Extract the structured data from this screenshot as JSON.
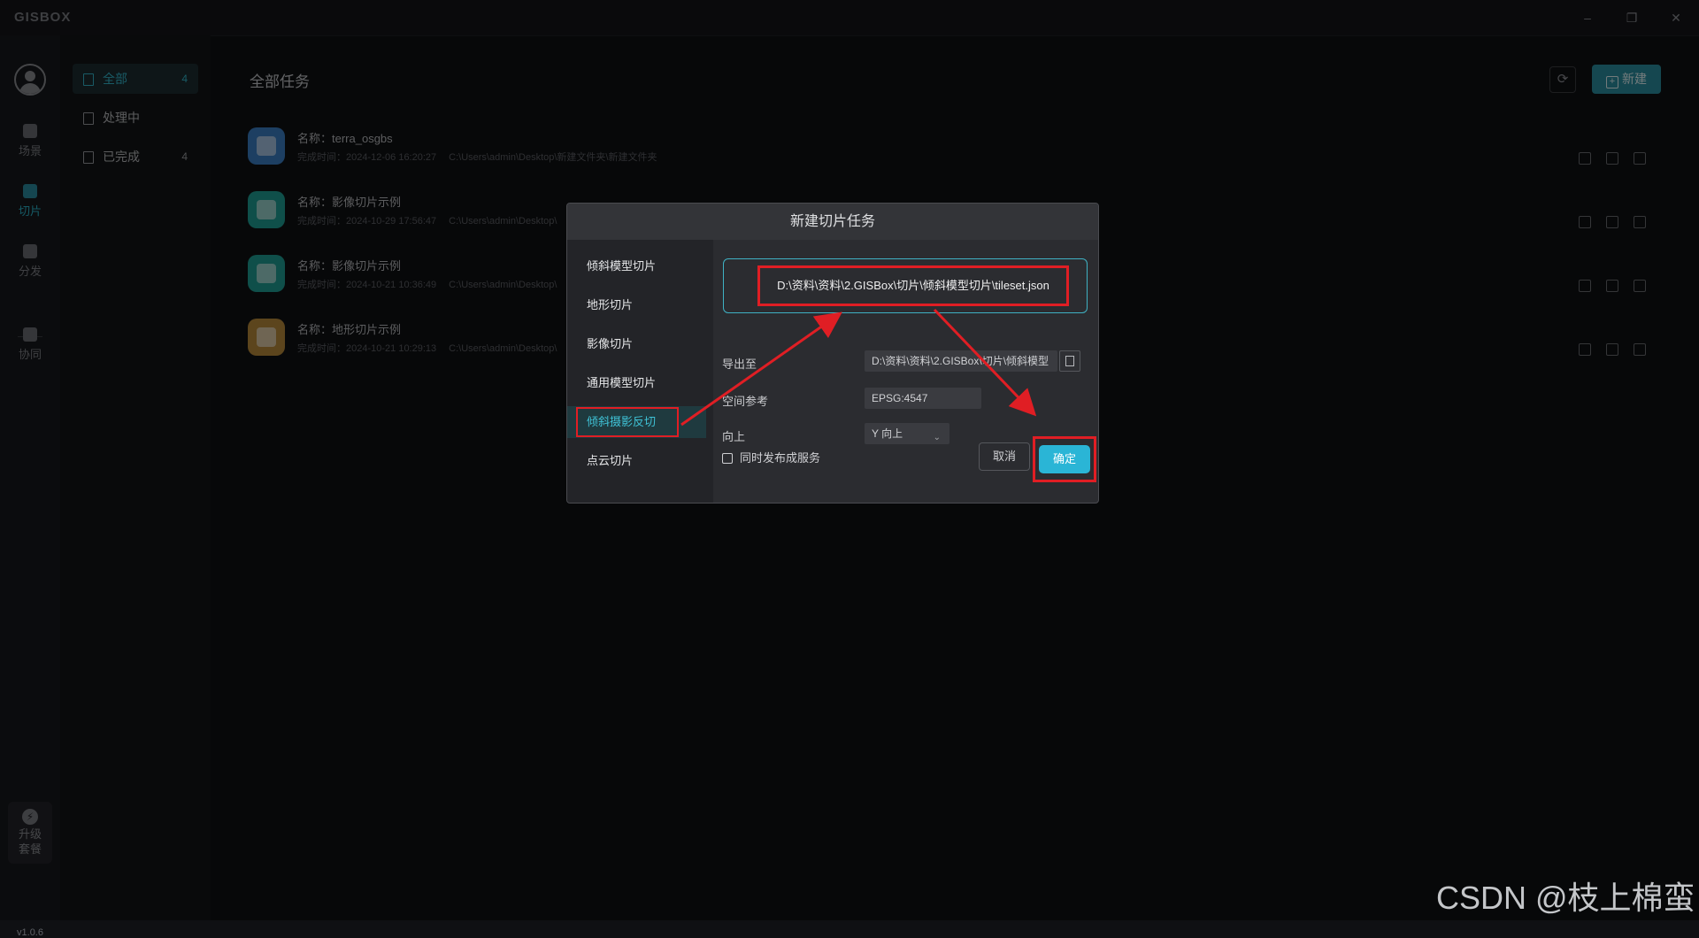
{
  "app": {
    "logo": "GISBOX",
    "window_controls": {
      "minimize": "–",
      "restore": "❐",
      "close": "✕"
    },
    "version": "v1.0.6"
  },
  "rail": {
    "items": [
      {
        "label": "场景",
        "icon": "home-icon"
      },
      {
        "label": "切片",
        "icon": "slice-icon",
        "active": true
      },
      {
        "label": "分发",
        "icon": "distribute-icon"
      },
      {
        "label": "协同",
        "icon": "lock-icon"
      }
    ],
    "upgrade": {
      "line1": "升级",
      "line2": "套餐",
      "icon": "bolt-icon",
      "glyph": "⚡"
    }
  },
  "filter": {
    "items": [
      {
        "label": "全部",
        "count": "4",
        "active": true
      },
      {
        "label": "处理中",
        "count": ""
      },
      {
        "label": "已完成",
        "count": "4"
      }
    ]
  },
  "main": {
    "title": "全部任务",
    "refresh_glyph": "⟳",
    "new_label": "新建",
    "new_plus": "+",
    "tasks": [
      {
        "name": "名称：terra_osgbs",
        "time": "完成时间：2024-12-06 16:20:27",
        "path": "C:\\Users\\admin\\Desktop\\新建文件夹\\新建文件夹",
        "color": "#3a7fc4"
      },
      {
        "name": "名称：影像切片示例",
        "time": "完成时间：2024-10-29 17:56:47",
        "path": "C:\\Users\\admin\\Desktop\\",
        "color": "#1f9f94"
      },
      {
        "name": "名称：影像切片示例",
        "time": "完成时间：2024-10-21 10:36:49",
        "path": "C:\\Users\\admin\\Desktop\\",
        "color": "#1f9f94"
      },
      {
        "name": "名称：地形切片示例",
        "time": "完成时间：2024-10-21 10:29:13",
        "path": "C:\\Users\\admin\\Desktop\\",
        "color": "#b98a3b"
      }
    ]
  },
  "dialog": {
    "title": "新建切片任务",
    "menu": [
      "倾斜模型切片",
      "地形切片",
      "影像切片",
      "通用模型切片",
      "倾斜摄影反切",
      "点云切片"
    ],
    "active_index": 4,
    "source_path": "D:\\资料\\资料\\2.GISBox\\切片\\倾斜模型切片\\tileset.json",
    "export_label": "导出至",
    "export_value": "D:\\资料\\资料\\2.GISBox\\切片\\倾斜模型",
    "srs_label": "空间参考",
    "srs_value": "EPSG:4547",
    "up_label": "向上",
    "up_value": "Y 向上",
    "up_chevron": "⌄",
    "publish_label": "同时发布成服务",
    "cancel_label": "取消",
    "ok_label": "确定"
  },
  "colors": {
    "accent": "#2bb3c8",
    "annotation_red": "#e01e24",
    "ok_button": "#2ab5d6"
  },
  "watermark": "CSDN @枝上棉蛮"
}
